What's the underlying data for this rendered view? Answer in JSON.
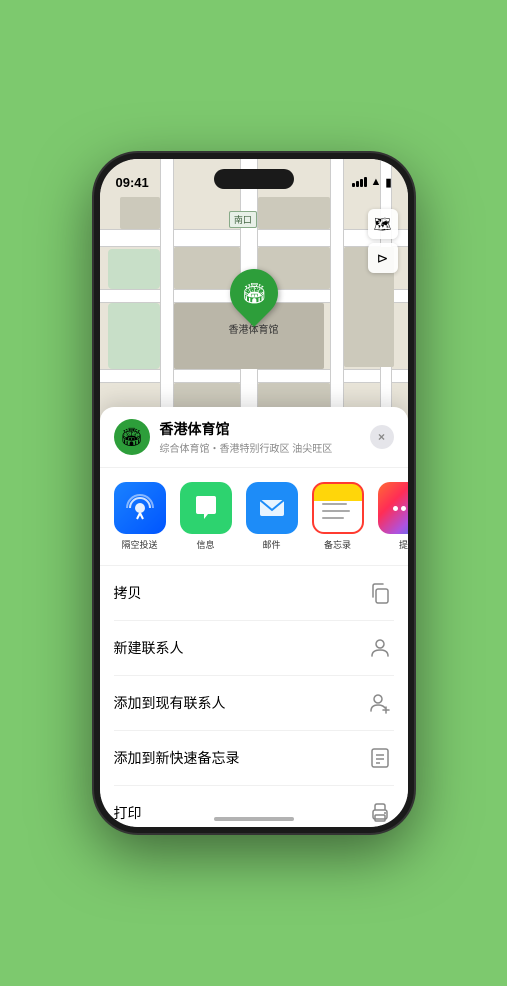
{
  "status_bar": {
    "time": "09:41",
    "location_arrow": "▶"
  },
  "map": {
    "south_entrance_label": "南口",
    "south_entrance_prefix": "南",
    "location_pin_label": "香港体育馆",
    "map_control_layers": "⊞",
    "map_control_location": "⊳"
  },
  "bottom_sheet": {
    "location_name": "香港体育馆",
    "location_subtitle": "综合体育馆・香港特别行政区 油尖旺区",
    "close_label": "×"
  },
  "share_apps": [
    {
      "id": "airdrop",
      "label": "隔空投送",
      "selected": false
    },
    {
      "id": "messages",
      "label": "信息",
      "selected": false
    },
    {
      "id": "mail",
      "label": "邮件",
      "selected": false
    },
    {
      "id": "notes",
      "label": "备忘录",
      "selected": true
    },
    {
      "id": "more",
      "label": "提",
      "selected": false
    }
  ],
  "actions": [
    {
      "id": "copy",
      "label": "拷贝",
      "icon": "copy"
    },
    {
      "id": "new-contact",
      "label": "新建联系人",
      "icon": "person"
    },
    {
      "id": "add-contact",
      "label": "添加到现有联系人",
      "icon": "person-add"
    },
    {
      "id": "quick-note",
      "label": "添加到新快速备忘录",
      "icon": "note"
    },
    {
      "id": "print",
      "label": "打印",
      "icon": "print"
    }
  ]
}
